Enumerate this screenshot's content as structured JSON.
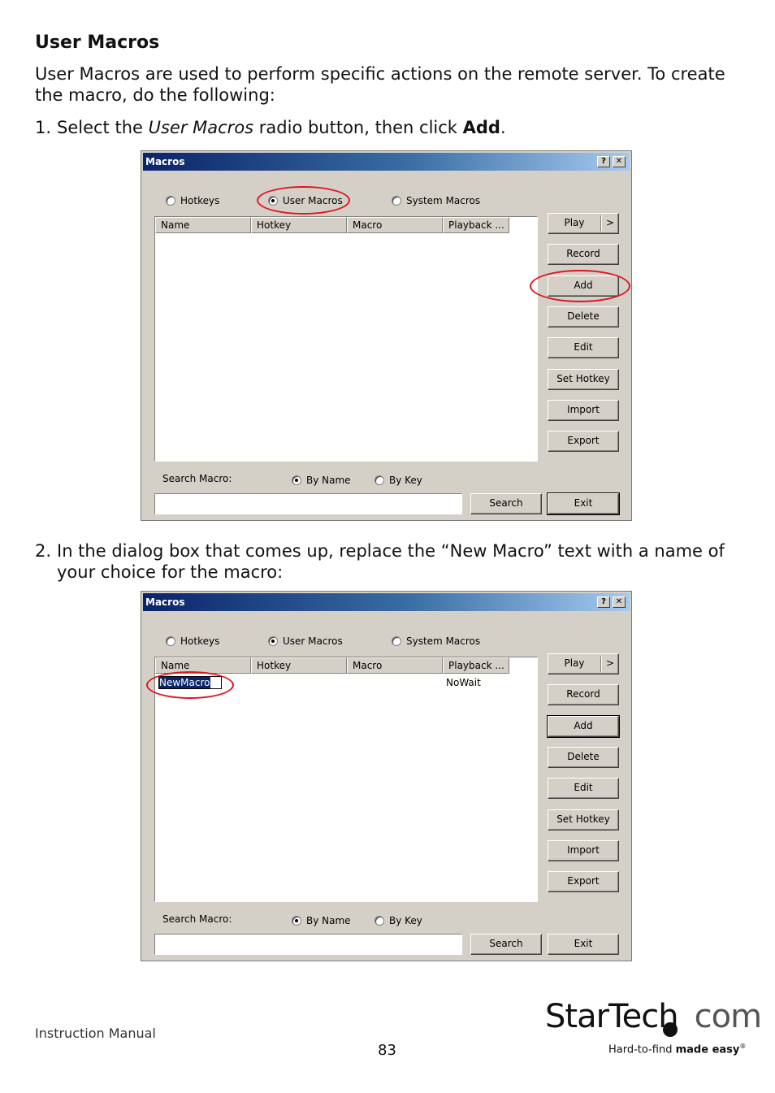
{
  "section": {
    "title": "User Macros"
  },
  "intro": "User Macros are used to perform specific actions on the remote server. To  create the macro, do the following:",
  "steps": [
    {
      "number": "1.",
      "pre": "Select the ",
      "em": "User Macros",
      "mid": " radio button, then click ",
      "strong": "Add",
      "post": "."
    },
    {
      "number": "2.",
      "text": "In the dialog box that comes up, replace the “New Macro” text with a name of your choice for the macro:"
    }
  ],
  "dialog": {
    "title": "Macros",
    "help_btn": "?",
    "close_btn": "✕",
    "radios": {
      "hotkeys": "Hotkeys",
      "user_macros": "User Macros",
      "system_macros": "System Macros"
    },
    "columns": [
      "Name",
      "Hotkey",
      "Macro",
      "Playback ..."
    ],
    "buttons": {
      "play": "Play",
      "play_more": ">",
      "record": "Record",
      "add": "Add",
      "delete": "Delete",
      "edit": "Edit",
      "set_hotkey": "Set Hotkey",
      "import": "Import",
      "export": "Export",
      "search": "Search",
      "exit": "Exit"
    },
    "search_label": "Search Macro:",
    "search_radios": {
      "by_name": "By Name",
      "by_key": "By Key"
    },
    "selected_type": "User Macros",
    "selected_search": "By Name"
  },
  "dialog2_row": {
    "name": "NewMacro",
    "playback": "NoWait"
  },
  "footer": {
    "left": "Instruction Manual",
    "page": "83"
  },
  "logo": {
    "brand": "StarTech",
    "brand_suffix": "com",
    "tagline_pre": "Hard-to-find ",
    "tagline_bold": "made easy",
    "reg": "®"
  },
  "highlight_color": "#e0141e"
}
